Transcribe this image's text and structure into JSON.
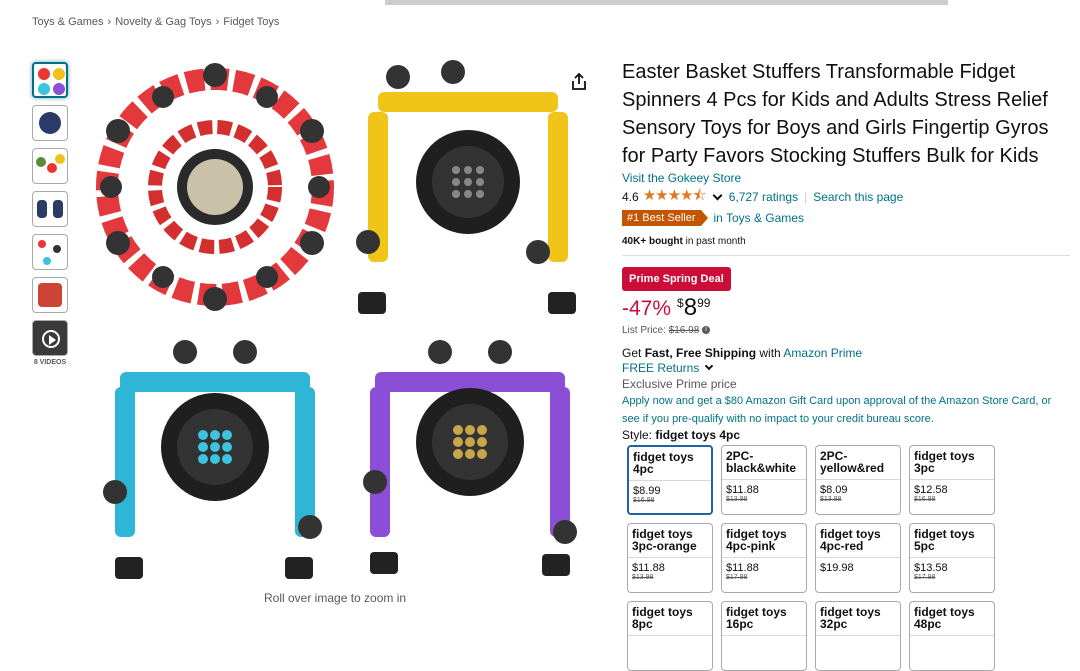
{
  "breadcrumb": [
    "Toys & Games",
    "Novelty & Gag Toys",
    "Fidget Toys"
  ],
  "thumbnails": [
    "image-1",
    "image-2",
    "image-3",
    "image-4",
    "image-5",
    "image-6"
  ],
  "videos_label": "8 VIDEOS",
  "zoom_hint": "Roll over image to zoom in",
  "product": {
    "title": "Easter Basket Stuffers Transformable Fidget Spinners 4 Pcs for Kids and Adults Stress Relief Sensory Toys for Boys and Girls Fingertip Gyros for Party Favors Stocking Stuffers Bulk for Kids",
    "store_link": "Visit the Gokeey Store",
    "rating": "4.6",
    "stars": "★★★★⯪",
    "ratings_count": "6,727 ratings",
    "search_page": "Search this page",
    "best_seller_badge": "#1 Best Seller",
    "best_seller_category": "in Toys & Games",
    "bought_bold": "40K+ bought",
    "bought_rest": "in past month",
    "deal_badge": "Prime Spring Deal",
    "discount": "-47%",
    "currency": "$",
    "price_whole": "8",
    "price_fraction": "99",
    "list_price_label": "List Price:",
    "list_price": "$16.98",
    "shipping_prefix": "Get",
    "shipping_bold": "Fast, Free Shipping",
    "shipping_with": "with",
    "shipping_link": "Amazon Prime",
    "free_returns": "FREE Returns",
    "exclusive": "Exclusive Prime price",
    "apply_text": "Apply now and get a $80 Amazon Gift Card upon approval of the Amazon Store Card, or see if you pre-qualify with no impact to your credit bureau score.",
    "style_label": "Style:",
    "style_value": "fidget toys 4pc"
  },
  "colors": {
    "accent": "#007185",
    "deal": "#cc0c39",
    "badge": "#c45500",
    "star": "#de7921"
  },
  "options": [
    {
      "name": "fidget toys 4pc",
      "price": "$8.99",
      "list": "$16.98",
      "selected": true
    },
    {
      "name": "2PC-black&white",
      "price": "$11.88",
      "list": "$13.98"
    },
    {
      "name": "2PC-yellow&red",
      "price": "$8.09",
      "list": "$13.98"
    },
    {
      "name": "fidget toys 3pc",
      "price": "$12.58",
      "list": "$16.98"
    },
    {
      "name": "fidget toys 3pc-orange",
      "price": "$11.88",
      "list": "$13.98"
    },
    {
      "name": "fidget toys 4pc-pink",
      "price": "$11.88",
      "list": "$17.98"
    },
    {
      "name": "fidget toys 4pc-red",
      "price": "$19.98",
      "list": ""
    },
    {
      "name": "fidget toys 5pc",
      "price": "$13.58",
      "list": "$17.98"
    },
    {
      "name": "fidget toys 8pc",
      "price": "",
      "list": ""
    },
    {
      "name": "fidget toys 16pc",
      "price": "",
      "list": ""
    },
    {
      "name": "fidget toys 32pc",
      "price": "",
      "list": ""
    },
    {
      "name": "fidget toys 48pc",
      "price": "",
      "list": ""
    }
  ]
}
